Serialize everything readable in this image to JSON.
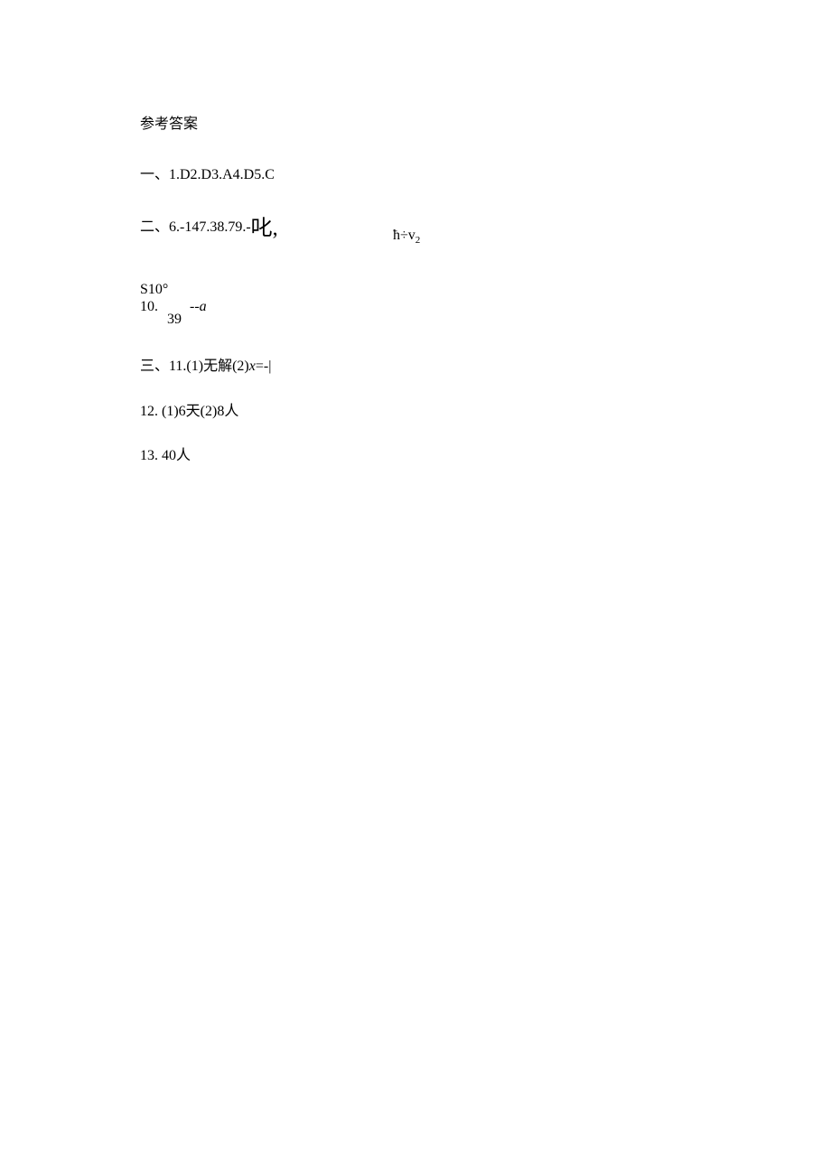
{
  "title": "参考答案",
  "section_one": "一、1.D2.D3.A4.D5.C",
  "section_two": {
    "main": "二、6.-147.38.79.-",
    "glyph": "叱,",
    "formula": "ħ÷v",
    "formula_sub": "2"
  },
  "block_s10": {
    "top": "S10°",
    "line2_left": "10.",
    "line2_a": "--a",
    "line2_39": "39"
  },
  "section_three": {
    "line1_prefix": "三、11.(1)无解(2)",
    "line1_x": "x",
    "line1_suffix": "=-|",
    "line2": "12.  (1)6天(2)8人",
    "line3": "13.  40人"
  }
}
